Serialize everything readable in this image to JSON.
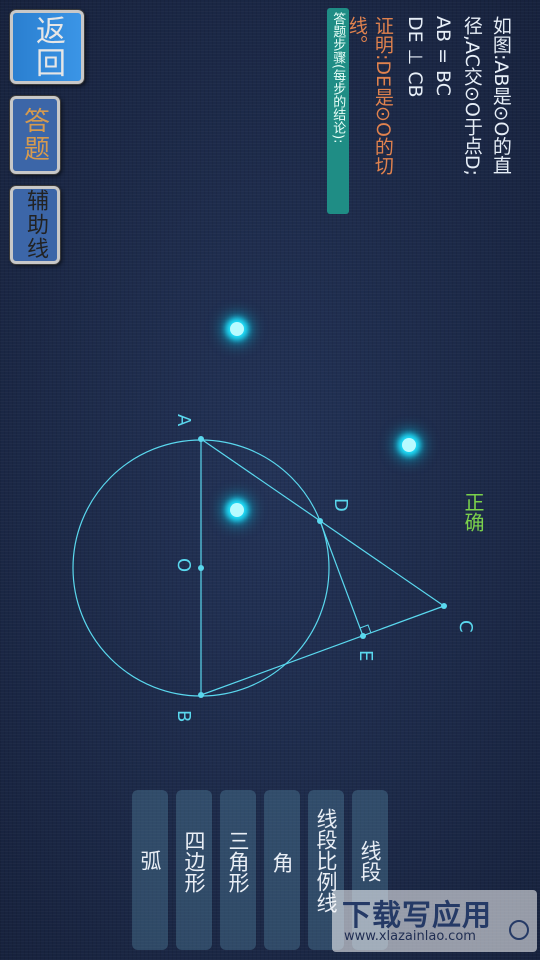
{
  "side_buttons": {
    "back_label": "返回",
    "answer_label": "答题",
    "aux_line_label": "辅助线"
  },
  "problem": {
    "line1": "如图:AB是⊙O的直",
    "line2": "径,AC交⊙O于点D;",
    "line3": "AB = BC",
    "line4": "DE ⊥ CB",
    "proof_line1": "证明:DE是⊙O的切",
    "proof_line2": "线。",
    "answer_steps_hint": "答题步骤(每步的结论):"
  },
  "status": {
    "result": "正确"
  },
  "diagram": {
    "labels": {
      "A": "A",
      "B": "B",
      "C": "C",
      "D": "D",
      "E": "E",
      "O": "O"
    },
    "line_color": "#5ad8ee"
  },
  "options": [
    {
      "label": "线段"
    },
    {
      "label": "线段比例线"
    },
    {
      "label": "角"
    },
    {
      "label": "三角形"
    },
    {
      "label": "四边形"
    },
    {
      "label": "弧"
    }
  ],
  "watermark": {
    "title": "下载写应用",
    "url": "www.xlazainlao.com"
  }
}
